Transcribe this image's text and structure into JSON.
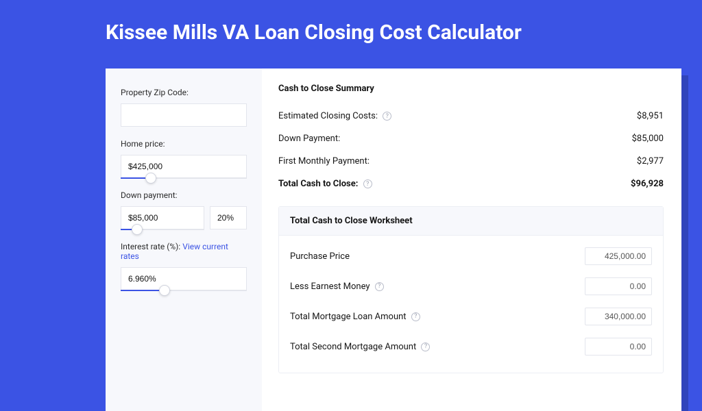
{
  "title": "Kissee Mills VA Loan Closing Cost Calculator",
  "sidebar": {
    "zip_label": "Property Zip Code:",
    "zip_value": "",
    "home_price_label": "Home price:",
    "home_price_value": "$425,000",
    "home_price_slider_pct": 24,
    "down_payment_label": "Down payment:",
    "down_payment_value": "$85,000",
    "down_payment_pct": "20%",
    "down_payment_slider_pct": 20,
    "interest_label": "Interest rate (%): ",
    "interest_link": "View current rates",
    "interest_value": "6.960%",
    "interest_slider_pct": 35
  },
  "summary": {
    "title": "Cash to Close Summary",
    "rows": [
      {
        "label": "Estimated Closing Costs:",
        "help": true,
        "value": "$8,951",
        "bold": false
      },
      {
        "label": "Down Payment:",
        "help": false,
        "value": "$85,000",
        "bold": false
      },
      {
        "label": "First Monthly Payment:",
        "help": false,
        "value": "$2,977",
        "bold": false
      },
      {
        "label": "Total Cash to Close:",
        "help": true,
        "value": "$96,928",
        "bold": true
      }
    ]
  },
  "worksheet": {
    "title": "Total Cash to Close Worksheet",
    "rows": [
      {
        "label": "Purchase Price",
        "help": false,
        "value": "425,000.00"
      },
      {
        "label": "Less Earnest Money",
        "help": true,
        "value": "0.00"
      },
      {
        "label": "Total Mortgage Loan Amount",
        "help": true,
        "value": "340,000.00"
      },
      {
        "label": "Total Second Mortgage Amount",
        "help": true,
        "value": "0.00"
      }
    ]
  }
}
